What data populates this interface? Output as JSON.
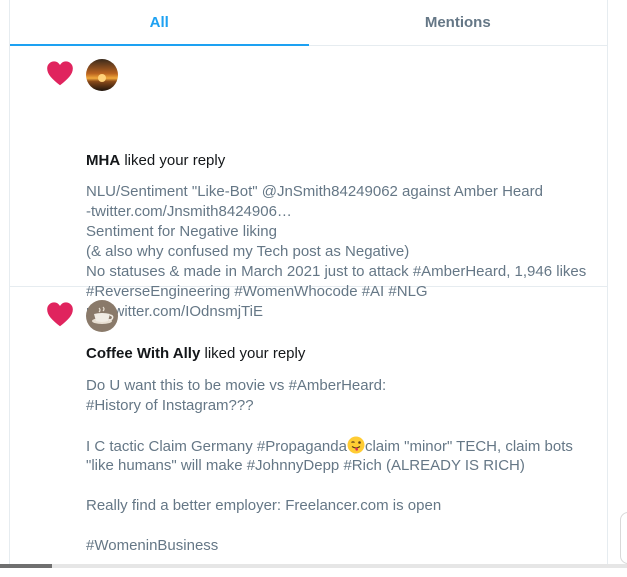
{
  "tabs": [
    {
      "label": "All",
      "active": true
    },
    {
      "label": "Mentions",
      "active": false
    }
  ],
  "colors": {
    "accent": "#1da1f2",
    "heart": "#e0245e",
    "secondary_text": "#657786",
    "primary_text": "#14171a"
  },
  "notifications": [
    {
      "icon": "heart-icon",
      "user": "MHA",
      "action": "liked your reply",
      "lines": [
        "NLU/Sentiment \"Like-Bot\" @JnSmith84249062 against Amber Heard",
        "-twitter.com/Jnsmith8424906…",
        "Sentiment for Negative liking",
        "(& also why confused my Tech post as Negative)",
        "No statuses & made in March 2021 just to attack #AmberHeard, 1,946 likes",
        "#ReverseEngineering #WomenWhocode #AI #NLG",
        "pic.twitter.com/IOdnsmjTiE"
      ]
    },
    {
      "icon": "heart-icon",
      "user": "Coffee With Ally",
      "action": "liked your reply",
      "lines": [
        "Do U want this to be movie vs #AmberHeard:",
        "#History of Instagram???",
        "",
        "I C tactic Claim Germany #Propaganda",
        "\"like humans\" will make #JohnnyDepp #Rich (ALREADY IS RICH)",
        "",
        "Really find a better employer: Freelancer.com is open",
        "",
        "#WomeninBusiness"
      ],
      "emoji_line_tail": "claim \"minor\" TECH, claim bots"
    }
  ]
}
